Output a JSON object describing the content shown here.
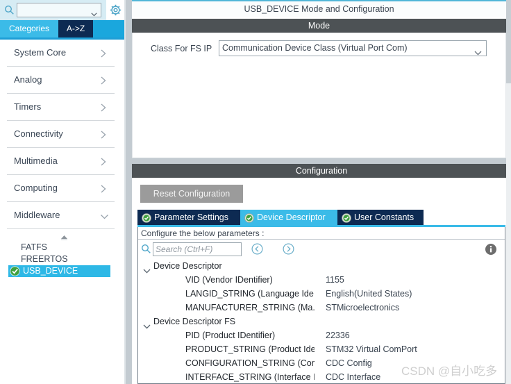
{
  "ip_search": {
    "value": "",
    "placeholder": "",
    "search_icon": "search-icon",
    "caret_icon": "chevron-down-icon",
    "gear_icon": "gear-icon"
  },
  "category_tabs": [
    {
      "label": "Categories",
      "active": true
    },
    {
      "label": "A->Z",
      "active": false
    }
  ],
  "categories": [
    {
      "label": "System Core",
      "chevron": "chevron-right-icon",
      "expanded": false
    },
    {
      "label": "Analog",
      "chevron": "chevron-right-icon",
      "expanded": false
    },
    {
      "label": "Timers",
      "chevron": "chevron-right-icon",
      "expanded": false
    },
    {
      "label": "Connectivity",
      "chevron": "chevron-right-icon",
      "expanded": false
    },
    {
      "label": "Multimedia",
      "chevron": "chevron-right-icon",
      "expanded": false
    },
    {
      "label": "Computing",
      "chevron": "chevron-right-icon",
      "expanded": false
    },
    {
      "label": "Middleware",
      "chevron": "chevron-down-icon",
      "expanded": true
    }
  ],
  "middleware_items": [
    {
      "label": "FATFS",
      "selected": false,
      "checked": false
    },
    {
      "label": "FREERTOS",
      "selected": false,
      "checked": false
    },
    {
      "label": "USB_DEVICE",
      "selected": true,
      "checked": true
    }
  ],
  "header": {
    "title": "USB_DEVICE Mode and Configuration"
  },
  "mode": {
    "section_title": "Mode",
    "class_label": "Class For FS IP",
    "class_value": "Communication Device Class (Virtual Port Com)",
    "caret_icon": "chevron-down-icon"
  },
  "configuration": {
    "section_title": "Configuration",
    "reset_label": "Reset Configuration",
    "tabs": [
      {
        "label": "Parameter Settings",
        "state": "dark",
        "icon": "check-circle-icon"
      },
      {
        "label": "Device Descriptor",
        "state": "light",
        "icon": "check-circle-icon"
      },
      {
        "label": "User Constants",
        "state": "dark",
        "icon": "check-circle-icon"
      }
    ],
    "caption": "Configure the below parameters :",
    "search_placeholder": "Search (Ctrl+F)",
    "search_value": "",
    "search_icon": "search-icon",
    "prev_icon": "circle-left-arrow-icon",
    "next_icon": "circle-right-arrow-icon",
    "info_icon": "info-icon",
    "tree": [
      {
        "type": "group",
        "label": "Device Descriptor",
        "caret": "chevron-down-icon"
      },
      {
        "type": "row",
        "name": "VID (Vendor IDentifier)",
        "value": "1155"
      },
      {
        "type": "row",
        "name": "LANGID_STRING (Language Ide...",
        "value": "English(United States)"
      },
      {
        "type": "row",
        "name": "MANUFACTURER_STRING (Ma...",
        "value": "STMicroelectronics"
      },
      {
        "type": "group",
        "label": "Device Descriptor FS",
        "caret": "chevron-down-icon"
      },
      {
        "type": "row",
        "name": "PID (Product IDentifier)",
        "value": "22336"
      },
      {
        "type": "row",
        "name": "PRODUCT_STRING (Product Ide...",
        "value": "STM32 Virtual ComPort"
      },
      {
        "type": "row",
        "name": "CONFIGURATION_STRING (Con...",
        "value": "CDC Config"
      },
      {
        "type": "row",
        "name": "INTERFACE_STRING (Interface I...",
        "value": "CDC Interface"
      }
    ]
  },
  "watermark": "CSDN @自小吃多",
  "colors": {
    "accent_light_blue": "#3bbbe8",
    "accent_dark_navy": "#0d2a52",
    "tab_strip_blue": "#1aa7dd",
    "section_header_gray": "#4d5255",
    "selection_blue": "#2eb8e6",
    "check_green": "#3fa13f",
    "reset_gray": "#9b9b9b",
    "text_dark": "#3a4450"
  }
}
